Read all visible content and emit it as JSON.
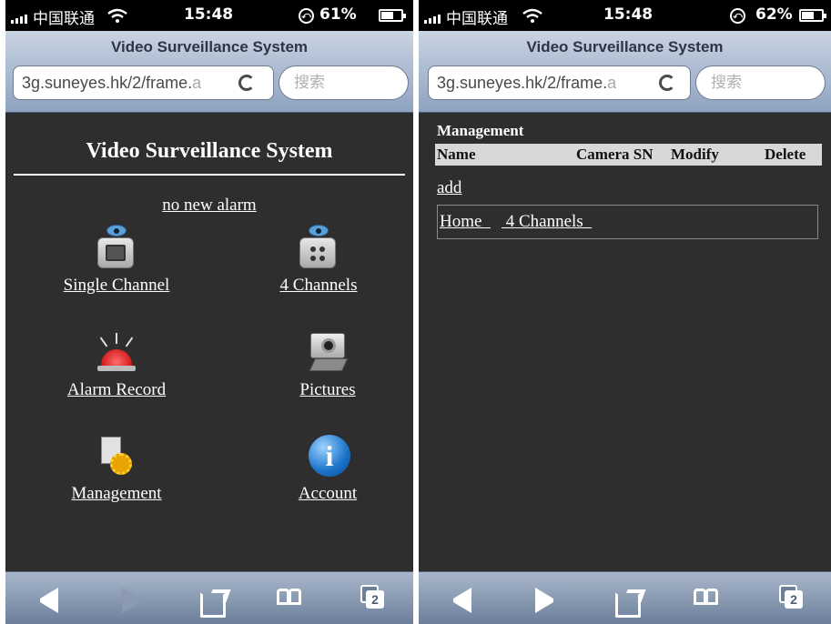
{
  "left": {
    "status": {
      "carrier": "中国联通",
      "time": "15:48",
      "battery_pct": "61%",
      "battery_level": 0.61
    },
    "browser": {
      "title": "Video Surveillance System",
      "url_main": "3g.suneyes.hk/2/frame.",
      "url_fade": "a",
      "search_placeholder": "搜索"
    },
    "page": {
      "heading": "Video Surveillance System",
      "alarm_link": "no new alarm",
      "tiles": {
        "single_channel": "Single Channel",
        "four_channels": "4 Channels",
        "alarm_record": "Alarm Record",
        "pictures": "Pictures",
        "management": "Management",
        "account": "Account"
      },
      "icons": {
        "single_channel": "camera-single-icon",
        "four_channels": "camera-quad-icon",
        "alarm_record": "alarm-siren-icon",
        "pictures": "photo-camera-icon",
        "management": "settings-gear-icon",
        "account": "info-icon"
      }
    },
    "toolbar": {
      "tab_count": "2"
    }
  },
  "right": {
    "status": {
      "carrier": "中国联通",
      "time": "15:48",
      "battery_pct": "62%",
      "battery_level": 0.62
    },
    "browser": {
      "title": "Video Surveillance System",
      "url_main": "3g.suneyes.hk/2/frame.",
      "url_fade": "a",
      "search_placeholder": "搜索"
    },
    "page": {
      "title": "Management",
      "columns": [
        "Name",
        "Camera SN",
        "Modify",
        "Delete"
      ],
      "add_link": "add",
      "nav": [
        "Home  ",
        " 4 Channels  "
      ]
    },
    "toolbar": {
      "tab_count": "2"
    }
  },
  "colors": {
    "page_bg": "#2e2e2e",
    "toolbar": "#8a9bb4",
    "header_row": "#d8d8d8"
  }
}
